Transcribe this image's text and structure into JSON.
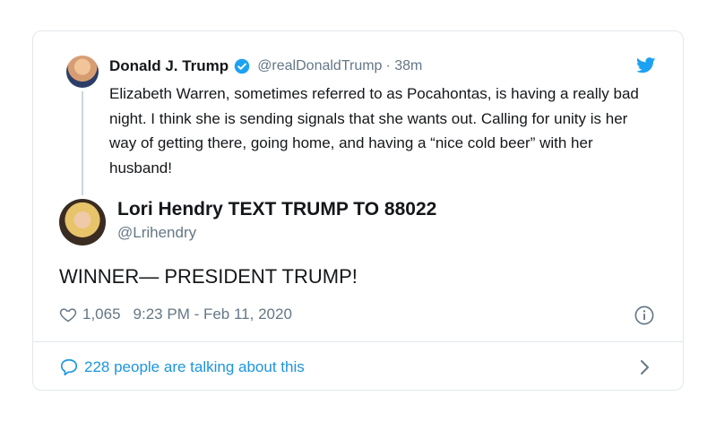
{
  "parent_tweet": {
    "name": "Donald J. Trump",
    "handle": "@realDonaldTrump",
    "time": "· 38m",
    "text": "Elizabeth Warren, sometimes referred to as Pocahontas, is having a really bad night. I think she is sending signals that she wants out. Calling for unity is her way of getting there, going home, and having a “nice cold beer” with her husband!",
    "verified": true
  },
  "main_tweet": {
    "name": "Lori Hendry TEXT TRUMP TO 88022",
    "handle": "@Lrihendry",
    "text": "WINNER—  PRESIDENT TRUMP!",
    "likes": "1,065",
    "timestamp": "9:23 PM - Feb 11, 2020"
  },
  "footer": {
    "talking_text": "228 people are talking about this"
  },
  "colors": {
    "accent": "#1b95e0",
    "muted": "#657786",
    "border": "#e1e8ed",
    "verified": "#1da1f2"
  },
  "icons": [
    "verified-badge-icon",
    "twitter-bird-icon",
    "heart-icon",
    "info-icon",
    "speech-bubble-icon",
    "chevron-right-icon"
  ]
}
